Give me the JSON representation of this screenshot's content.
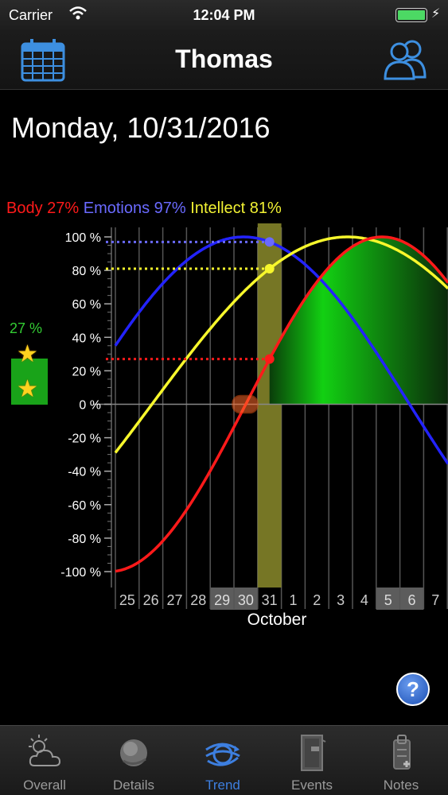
{
  "status_bar": {
    "carrier": "Carrier",
    "time": "12:04 PM"
  },
  "nav": {
    "title": "Thomas"
  },
  "date_heading": "Monday, 10/31/2016",
  "side_indicator": {
    "percent_label": "27 %",
    "stars": 2
  },
  "colors": {
    "body": "#ff1a1a",
    "emotions": "#2323ff",
    "intellect": "#f7f72c",
    "positive_fill": "#13d613",
    "highlight": "#8b8b2c",
    "accent": "#3d7fe0"
  },
  "chart_data": {
    "type": "line",
    "legend": {
      "body": "Body 27%",
      "emotions": "Emotions 97%",
      "intellect": "Intellect 81%"
    },
    "y_ticks": [
      "100 %",
      "80 %",
      "60 %",
      "40 %",
      "20 %",
      "0 %",
      "-20 %",
      "-40 %",
      "-60 %",
      "-80 %",
      "-100 %"
    ],
    "ylim": [
      -100,
      100
    ],
    "x_tick_labels": [
      "25",
      "26",
      "27",
      "28",
      "29",
      "30",
      "31",
      "1",
      "2",
      "3",
      "4",
      "5",
      "6",
      "7"
    ],
    "weekend_days": [
      "29",
      "30",
      "5",
      "6"
    ],
    "selected_day": "31",
    "xlabel": "October",
    "cycle_lengths_days": {
      "body": 23,
      "emotions": 28,
      "intellect": 33
    },
    "selected_values": {
      "body": 27,
      "emotions": 97,
      "intellect": 81
    },
    "series": [
      {
        "name": "Body",
        "color": "#ff1a1a",
        "cycle_days": 23,
        "value_at_selected": 27
      },
      {
        "name": "Emotions",
        "color": "#2323ff",
        "cycle_days": 28,
        "value_at_selected": 97
      },
      {
        "name": "Intellect",
        "color": "#f7f72c",
        "cycle_days": 33,
        "value_at_selected": 81
      }
    ]
  },
  "tabs": [
    {
      "label": "Overall",
      "icon": "weather-icon",
      "active": false
    },
    {
      "label": "Details",
      "icon": "globe-icon",
      "active": false
    },
    {
      "label": "Trend",
      "icon": "trend-arrows-icon",
      "active": true
    },
    {
      "label": "Events",
      "icon": "door-icon",
      "active": false
    },
    {
      "label": "Notes",
      "icon": "notepad-icon",
      "active": false
    }
  ],
  "help": {
    "label": "?"
  }
}
